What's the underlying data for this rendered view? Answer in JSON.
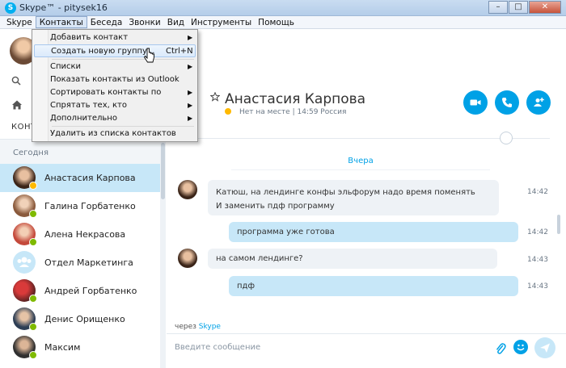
{
  "window": {
    "title": "Skype™ - pitysek16",
    "minimize": "–",
    "maximize": "□",
    "close": "✕"
  },
  "menubar": [
    "Skype",
    "Контакты",
    "Беседа",
    "Звонки",
    "Вид",
    "Инструменты",
    "Помощь"
  ],
  "dropdown": {
    "items": [
      {
        "label": "Добавить контакт",
        "submenu": true
      },
      {
        "label": "Создать новую группу...",
        "shortcut": "Ctrl+N",
        "highlighted": true
      },
      {
        "label": "Списки",
        "submenu": true
      },
      {
        "label": "Показать контакты из Outlook"
      },
      {
        "label": "Сортировать контакты по",
        "submenu": true
      },
      {
        "label": "Спрятать тех, кто",
        "submenu": true
      },
      {
        "label": "Дополнительно",
        "submenu": true
      },
      {
        "label": "Удалить из списка контактов"
      }
    ]
  },
  "sidebar": {
    "tab_label": "КОНТ",
    "section": "Сегодня",
    "contacts": [
      {
        "name": "Анастасия Карпова",
        "status": "away",
        "selected": true
      },
      {
        "name": "Галина Горбатенко",
        "status": "online"
      },
      {
        "name": "Алена Некрасова",
        "status": "online"
      },
      {
        "name": "Отдел Маркетинга",
        "status": "group"
      },
      {
        "name": "Андрей Горбатенко",
        "status": "online"
      },
      {
        "name": "Денис Орищенко",
        "status": "online"
      },
      {
        "name": "Максим",
        "status": "online"
      }
    ]
  },
  "conversation": {
    "name": "Анастасия Карпова",
    "status": "Нет на месте",
    "status_detail": "| 14:59 Россия",
    "day_label": "Вчера",
    "messages": [
      {
        "dir": "in",
        "lines": [
          "Катюш, на лендинге конфы эльфорум надо время поменять",
          "И заменить пдф программу"
        ],
        "time": "14:42"
      },
      {
        "dir": "out",
        "lines": [
          "программа уже готова"
        ],
        "time": "14:42"
      },
      {
        "dir": "in",
        "lines": [
          "на самом лендинге?"
        ],
        "time": "14:43"
      },
      {
        "dir": "out",
        "lines": [
          "пдф"
        ],
        "time": "14:43"
      }
    ],
    "via_prefix": "через",
    "via_service": "Skype",
    "compose_placeholder": "Введите сообщение"
  },
  "colors": {
    "accent": "#00a1e6",
    "selected": "#c7e7f8",
    "online": "#7fba00",
    "away": "#ffb900"
  }
}
